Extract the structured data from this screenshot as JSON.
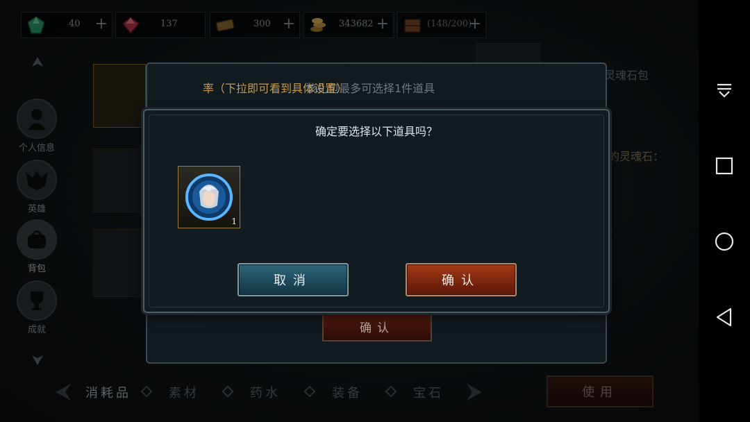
{
  "resources": [
    {
      "icon": "green-gem-icon",
      "value": "40"
    },
    {
      "icon": "red-gem-icon",
      "value": "137"
    },
    {
      "icon": "ticket-icon",
      "value": "300"
    },
    {
      "icon": "gold-coins-icon",
      "value": "343682"
    },
    {
      "icon": "crate-icon",
      "value": "(148/200)"
    }
  ],
  "sidebar": {
    "items": [
      {
        "label": "个人信息",
        "icon": "person-icon"
      },
      {
        "label": "英雄",
        "icon": "hero-mask-icon"
      },
      {
        "label": "背包",
        "icon": "backpack-icon"
      },
      {
        "label": "成就",
        "icon": "trophy-icon"
      }
    ]
  },
  "background": {
    "soul_pack_label": "灵魂石包",
    "soul_stone_label": "的灵魂石："
  },
  "tabs": [
    {
      "label": "消耗品"
    },
    {
      "label": "素材"
    },
    {
      "label": "药水"
    },
    {
      "label": "装备"
    },
    {
      "label": "宝石"
    }
  ],
  "use_button": "使用",
  "back_dialog": {
    "title_partial": "率（下拉即可看到具体设置）",
    "title_main": "该礼包最多可选择1件道具",
    "confirm_label": "确认"
  },
  "dialog": {
    "question": "确定要选择以下道具吗？",
    "item": {
      "icon": "hero-portrait-orb-icon",
      "count": "1"
    },
    "cancel_label": "取消",
    "confirm_label": "确认"
  },
  "colors": {
    "cancel_button": "#2d6678",
    "confirm_button": "#a23a16",
    "title_gold": "#c89a48"
  }
}
